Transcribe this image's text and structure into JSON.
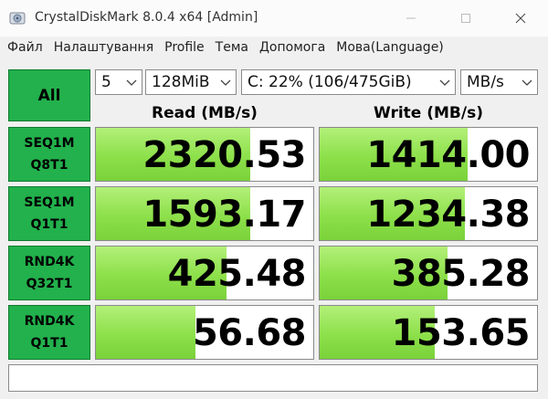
{
  "window": {
    "title": "CrystalDiskMark 8.0.4 x64 [Admin]"
  },
  "menu": [
    "Файл",
    "Налаштування",
    "Profile",
    "Тема",
    "Допомога",
    "Мова(Language)"
  ],
  "controls": {
    "all_label": "All",
    "count": "5",
    "size": "128MiB",
    "drive": "C: 22% (106/475GiB)",
    "unit": "MB/s"
  },
  "headers": {
    "read": "Read (MB/s)",
    "write": "Write (MB/s)"
  },
  "tests": [
    {
      "line1": "SEQ1M",
      "line2": "Q8T1",
      "read": "2320.53",
      "write": "1414.00",
      "read_fill": 0.71,
      "write_fill": 0.68
    },
    {
      "line1": "SEQ1M",
      "line2": "Q1T1",
      "read": "1593.17",
      "write": "1234.38",
      "read_fill": 0.71,
      "write_fill": 0.67
    },
    {
      "line1": "RND4K",
      "line2": "Q32T1",
      "read": "425.48",
      "write": "385.28",
      "read_fill": 0.6,
      "write_fill": 0.59
    },
    {
      "line1": "RND4K",
      "line2": "Q1T1",
      "read": "56.68",
      "write": "153.65",
      "read_fill": 0.46,
      "write_fill": 0.53
    }
  ],
  "comment": "",
  "colors": {
    "accent_green": "#22b14c",
    "bar_green": "#8de04a"
  }
}
